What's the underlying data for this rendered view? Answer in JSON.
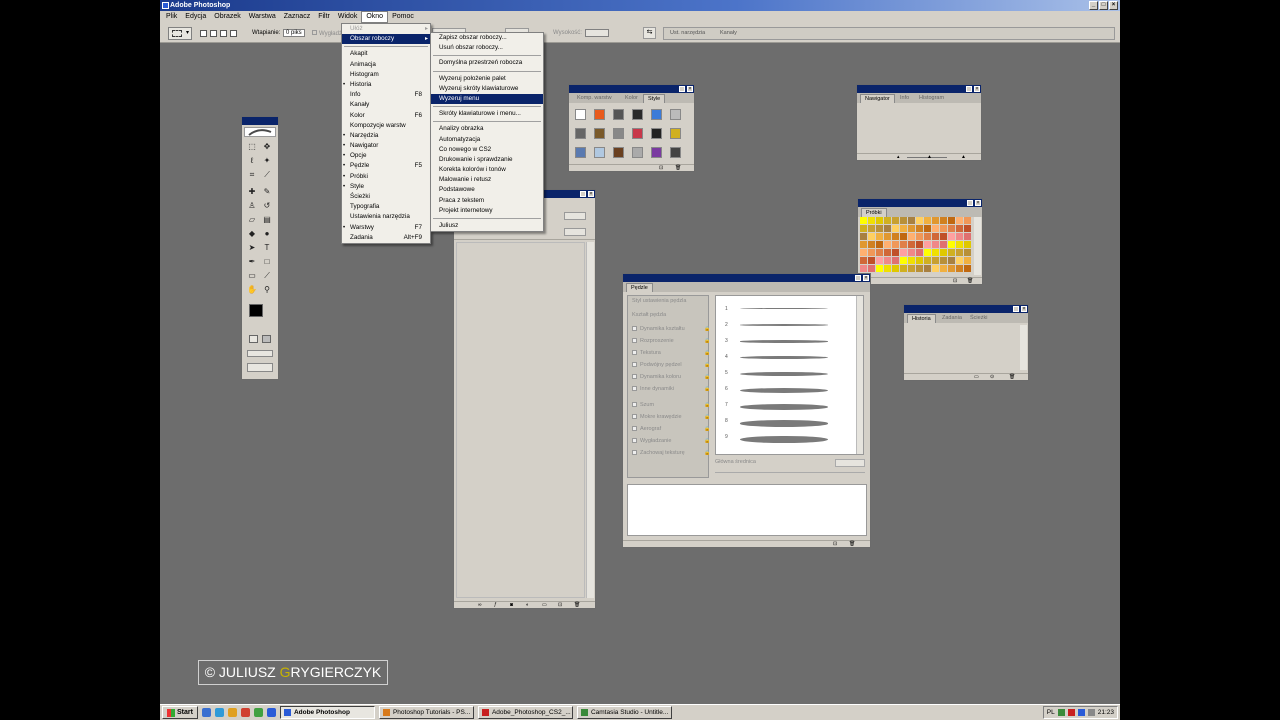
{
  "app": {
    "title": "Adobe Photoshop"
  },
  "menubar": [
    "Plik",
    "Edycja",
    "Obrazek",
    "Warstwa",
    "Zaznacz",
    "Filtr",
    "Widok",
    "Okno",
    "Pomoc"
  ],
  "options_bar": {
    "feather_label": "Wtapianie:",
    "feather_value": "0 piks",
    "faded_label": "Wygładź",
    "height_label": "Wysokość:",
    "well_tabs": [
      "Ust. narzędzia",
      "Kanały"
    ]
  },
  "okno_menu": {
    "items": [
      {
        "label": "Ułóż",
        "submenu": true,
        "disabled": true
      },
      {
        "label": "Obszar roboczy",
        "submenu": true,
        "selected": true
      },
      {
        "sep": true
      },
      {
        "label": "Akapit"
      },
      {
        "label": "Animacja"
      },
      {
        "label": "Histogram"
      },
      {
        "label": "Historia",
        "checked": true
      },
      {
        "label": "Info",
        "shortcut": "F8"
      },
      {
        "label": "Kanały"
      },
      {
        "label": "Kolor",
        "shortcut": "F6"
      },
      {
        "label": "Kompozycje warstw"
      },
      {
        "label": "Narzędzia",
        "checked": true
      },
      {
        "label": "Nawigator",
        "checked": true
      },
      {
        "label": "Opcje",
        "checked": true
      },
      {
        "label": "Pędzle",
        "shortcut": "F5",
        "checked": true
      },
      {
        "label": "Próbki",
        "checked": true
      },
      {
        "label": "Style",
        "checked": true
      },
      {
        "label": "Ścieżki"
      },
      {
        "label": "Typografia"
      },
      {
        "label": "Ustawienia narzędzia"
      },
      {
        "label": "Warstwy",
        "shortcut": "F7",
        "checked": true
      },
      {
        "label": "Zadania",
        "shortcut": "Alt+F9"
      }
    ]
  },
  "workspace_submenu": {
    "items": [
      {
        "label": "Zapisz obszar roboczy..."
      },
      {
        "label": "Usuń obszar roboczy..."
      },
      {
        "sep": true
      },
      {
        "label": "Domyślna przestrzeń robocza"
      },
      {
        "sep": true
      },
      {
        "label": "Wyzeruj położenie palet"
      },
      {
        "label": "Wyzeruj skróty klawiaturowe"
      },
      {
        "label": "Wyzeruj menu",
        "selected": true
      },
      {
        "sep": true
      },
      {
        "label": "Skróty klawiaturowe i menu..."
      },
      {
        "sep": true
      },
      {
        "label": "Analizy obrazka"
      },
      {
        "label": "Automatyzacja"
      },
      {
        "label": "Co nowego w CS2"
      },
      {
        "label": "Drukowanie i sprawdzanie"
      },
      {
        "label": "Korekta kolorów i tonów"
      },
      {
        "label": "Malowanie i retusz"
      },
      {
        "label": "Podstawowe"
      },
      {
        "label": "Praca z tekstem"
      },
      {
        "label": "Projekt internetowy"
      },
      {
        "sep": true
      },
      {
        "label": "Juliusz"
      }
    ]
  },
  "styles_palette": {
    "tabs": [
      "Komp. warstw",
      "Kolor",
      "Style"
    ],
    "active": "Style"
  },
  "navigator_palette": {
    "tabs": [
      "Nawigator",
      "Info",
      "Histogram"
    ],
    "active": "Nawigator"
  },
  "swatches_palette": {
    "tabs": [
      "Próbki"
    ]
  },
  "history_palette": {
    "tabs": [
      "Historia",
      "Zadania",
      "Ścieżki"
    ],
    "active": "Historia"
  },
  "brushes_palette": {
    "tab": "Pędzle",
    "section_labels": [
      "Styl ustawienia pędzla",
      "Kształt pędzla"
    ],
    "options": [
      "Dynamika kształtu",
      "Rozproszenie",
      "Tekstura",
      "Podwójny pędzel",
      "Dynamika koloru",
      "Inne dynamiki",
      "Szum",
      "Mokre krawędzie",
      "Aerograf",
      "Wygładzanie",
      "Zachowaj teksturę"
    ],
    "brush_numbers": [
      "1",
      "2",
      "3",
      "4",
      "5",
      "6",
      "7",
      "8",
      "9"
    ],
    "diameter_label": "Główna średnica"
  },
  "watermark": {
    "prefix": "© JULIUSZ ",
    "highlight": "G",
    "suffix": "RYGIERCZYK"
  },
  "taskbar": {
    "start": "Start",
    "tasks": [
      {
        "label": "Adobe Photoshop",
        "active": true,
        "color": "#2a5bd7"
      },
      {
        "label": "Photoshop Tutorials - PS...",
        "color": "#d87a1a"
      },
      {
        "label": "Adobe_Photoshop_CS2_...",
        "color": "#c82020"
      },
      {
        "label": "Camtasia Studio - Untitle...",
        "color": "#3a8a3a"
      }
    ],
    "lang": "PL",
    "clock": "21:23"
  }
}
